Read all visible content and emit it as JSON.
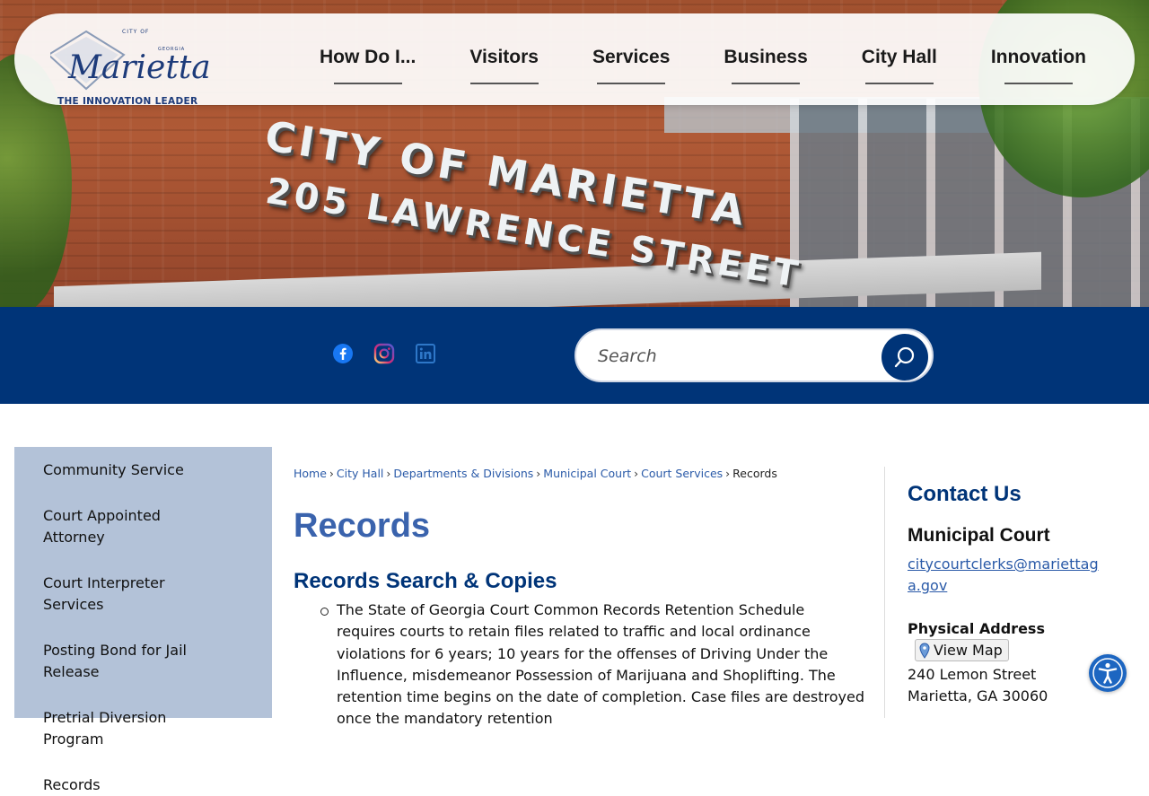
{
  "brand": {
    "logo_city_of": "CITY OF",
    "logo_name": "Marietta",
    "logo_state": "GEORGIA",
    "tagline": "THE INNOVATION LEADER",
    "color_primary": "#003478",
    "color_accent": "#3a63ad"
  },
  "hero": {
    "sign_line1": "CITY OF MARIETTA",
    "sign_line2": "205 LAWRENCE STREET"
  },
  "nav": {
    "items": [
      {
        "label": "How Do I..."
      },
      {
        "label": "Visitors"
      },
      {
        "label": "Services"
      },
      {
        "label": "Business"
      },
      {
        "label": "City Hall"
      },
      {
        "label": "Innovation"
      }
    ]
  },
  "social": {
    "icons": [
      "facebook-icon",
      "instagram-icon",
      "linkedin-icon"
    ]
  },
  "search": {
    "placeholder": "Search",
    "button_icon": "search-icon"
  },
  "sidebar": {
    "items": [
      {
        "label": "Community Service"
      },
      {
        "label": "Court Appointed Attorney"
      },
      {
        "label": "Court Interpreter Services"
      },
      {
        "label": "Posting Bond for Jail Release"
      },
      {
        "label": "Pretrial Diversion Program"
      },
      {
        "label": "Records"
      }
    ]
  },
  "breadcrumb": {
    "items": [
      {
        "label": "Home"
      },
      {
        "label": "City Hall"
      },
      {
        "label": "Departments & Divisions"
      },
      {
        "label": "Municipal Court"
      },
      {
        "label": "Court Services"
      }
    ],
    "current": "Records",
    "separator": "›"
  },
  "main": {
    "title": "Records",
    "section_title": "Records Search & Copies",
    "paragraph": "The State of Georgia Court Common Records Retention Schedule requires courts to retain files related to traffic and local ordinance violations for 6 years; 10 years for the offenses of Driving Under the Influence, misdemeanor Possession of Marijuana and Shoplifting. The retention time begins on the date of completion. Case files are destroyed once the mandatory retention"
  },
  "contact": {
    "title": "Contact Us",
    "department": "Municipal Court",
    "email": "citycourtclerks@mariettaga.gov",
    "address_label": "Physical Address",
    "map_button": "View Map",
    "address_line1": "240 Lemon Street",
    "address_line2": "Marietta, GA 30060"
  },
  "accessibility": {
    "icon": "accessibility-icon"
  }
}
